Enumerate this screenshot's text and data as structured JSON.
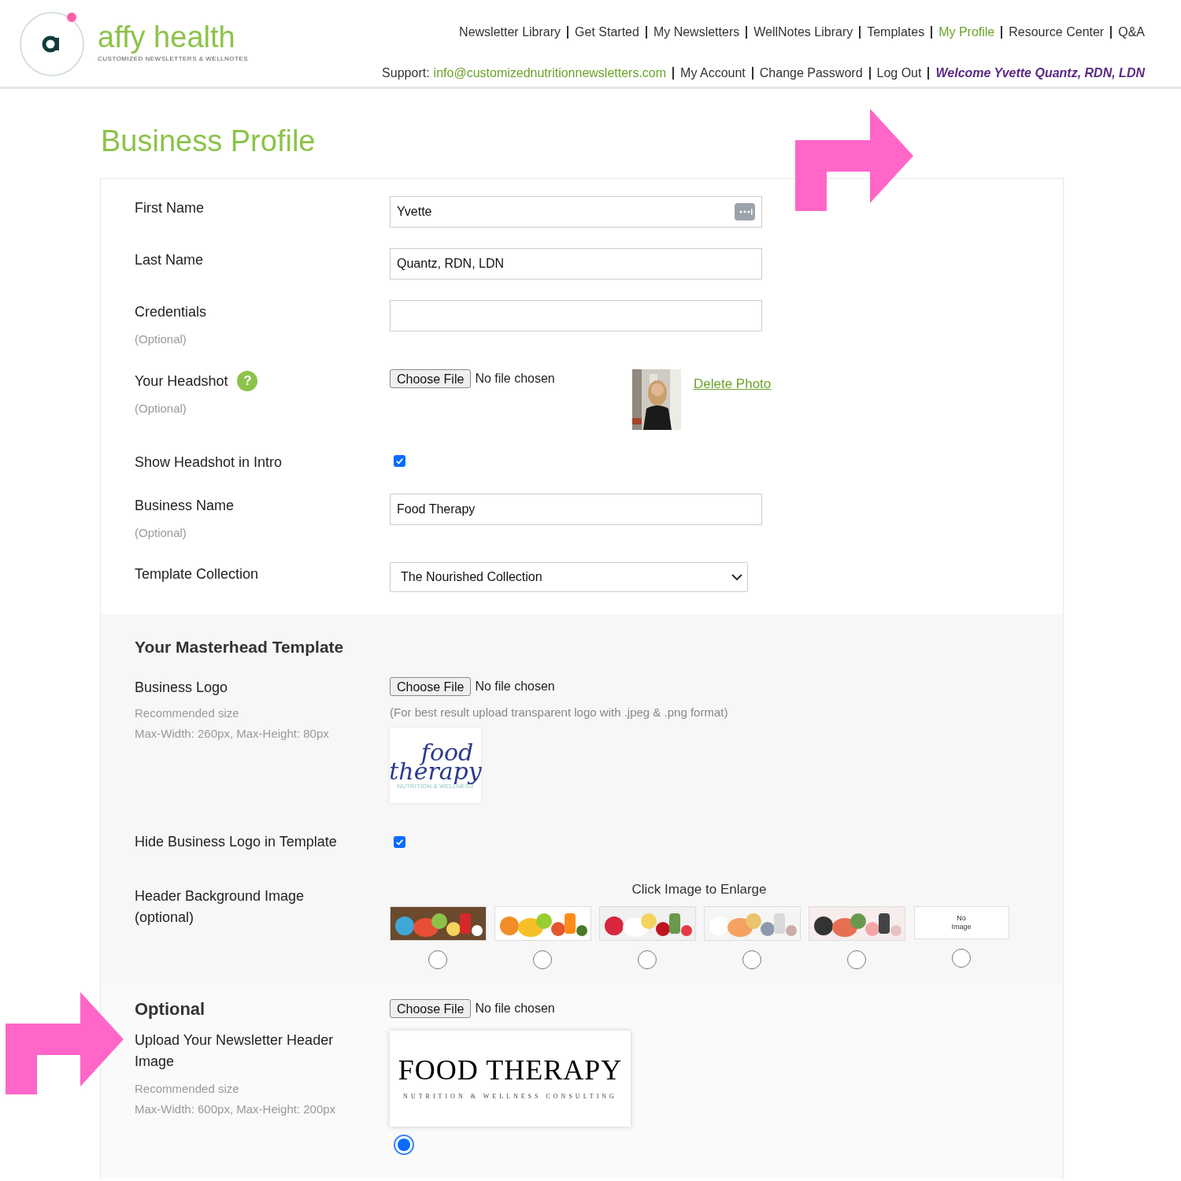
{
  "logo": {
    "name": "affy health",
    "tagline": "CUSTOMIZED NEWSLETTERS & WELLNOTES"
  },
  "nav": {
    "links": [
      {
        "label": "Newsletter Library",
        "selected": false
      },
      {
        "label": "Get Started",
        "selected": false
      },
      {
        "label": "My Newsletters",
        "selected": false
      },
      {
        "label": "WellNotes Library",
        "selected": false
      },
      {
        "label": "Templates",
        "selected": false
      },
      {
        "label": "My Profile",
        "selected": true
      },
      {
        "label": "Resource Center",
        "selected": false
      },
      {
        "label": "Q&A",
        "selected": false
      }
    ],
    "support_label": "Support:",
    "support_email": "info@customizednutritionnewsletters.com",
    "account_links": [
      "My Account",
      "Change Password",
      "Log Out"
    ],
    "welcome": "Welcome Yvette Quantz, RDN, LDN"
  },
  "page_title": "Business Profile",
  "fields": [
    {
      "kind": "text",
      "label": "First Name",
      "value": "Yvette",
      "autofill": true
    },
    {
      "kind": "text",
      "label": "Last Name",
      "value": "Quantz, RDN, LDN",
      "autofill": false
    },
    {
      "kind": "text",
      "label": "Credentials",
      "hint": "(Optional)",
      "autofill": false
    },
    {
      "label": "Your Headshot",
      "help_icon": "?",
      "hint": "(Optional)",
      "button": "Choose File",
      "file_status": "No file chosen",
      "delete_link": "Delete Photo"
    },
    {
      "kind": "checkbox",
      "label": "Show Headshot in Intro",
      "checked": true
    },
    {
      "kind": "text",
      "label": "Business Name",
      "hint": "(Optional)",
      "value": "Food Therapy",
      "autofill": false
    },
    {
      "kind": "select",
      "label": "Template Collection",
      "value": "The Nourished Collection"
    }
  ],
  "masthead": {
    "title": "Your Masterhead Template",
    "logo": {
      "label": "Business Logo",
      "hint_lines": [
        "Recommended size",
        "Max-Width: 260px, Max-Height: 80px"
      ],
      "button": "Choose File",
      "file_status": "No file chosen",
      "note": "(For best result upload transparent logo with .jpeg & .png format)",
      "image": {
        "line1": "food",
        "line2": "therapy",
        "sub": "NUTRITION & WELLNESS"
      }
    },
    "hide_logo": {
      "label": "Hide Business Logo in Template",
      "checked": true
    },
    "header_background": {
      "label": "Header Background Image",
      "sublabel": "(optional)",
      "caption": "Click Image to Enlarge",
      "options": [
        {
          "kind": "picture",
          "selected": false
        },
        {
          "kind": "picture",
          "selected": false
        },
        {
          "kind": "picture",
          "selected": false
        },
        {
          "kind": "picture",
          "selected": false
        },
        {
          "kind": "picture",
          "selected": false
        },
        {
          "kind": "empty",
          "label": "No Image",
          "selected": false
        }
      ]
    }
  },
  "custom_header": {
    "title": "Optional",
    "label": "Upload Your Newsletter Header Image",
    "hint_lines": [
      "Recommended size",
      "Max-Width: 600px, Max-Height: 200px"
    ],
    "button": "Choose File",
    "file_status": "No file chosen",
    "image": {
      "title": "FOOD THERAPY",
      "subtitle": "NUTRITION & WELLNESS CONSULTING"
    },
    "selected": true
  }
}
